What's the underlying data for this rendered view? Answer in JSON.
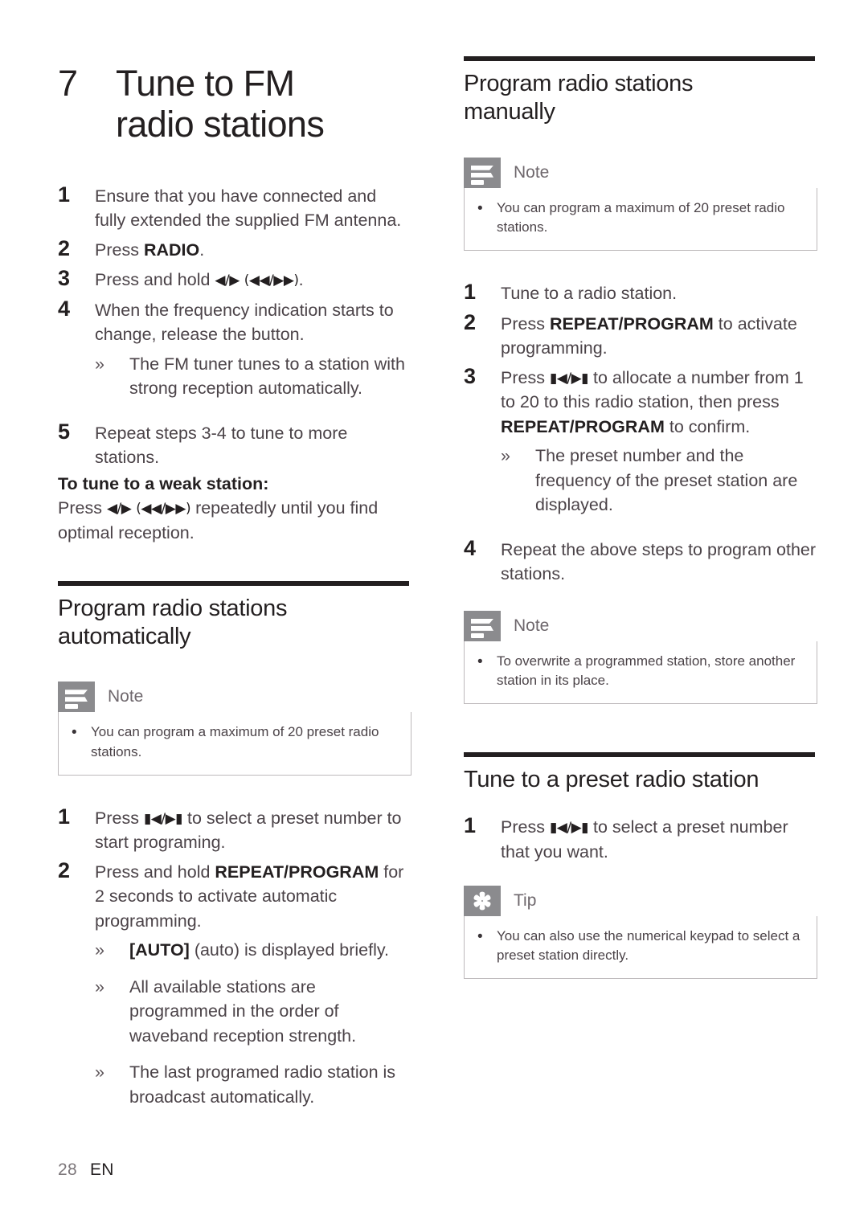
{
  "document": {
    "chapter_number": "7",
    "chapter_title_line1": "Tune to FM",
    "chapter_title_line2": "radio stations",
    "footer_page": "28",
    "footer_language": "EN"
  },
  "symbols": {
    "prev_next": "◀/▶",
    "rew_ff": "(◀◀/▶▶)",
    "skip_prev_next": "▮◀/▶▮"
  },
  "icons": {
    "note": "note-icon",
    "tip": "tip-icon",
    "bullet": "•",
    "subbullet": "»"
  },
  "colors": {
    "rule": "#231f20",
    "icon_badge": "#8b8b8e",
    "callout_border": "#bdb9bb",
    "body_text": "#4b4348",
    "heading_text": "#231f20"
  },
  "left_column": {
    "tune_fm_steps": [
      {
        "num": "1",
        "text": "Ensure that you have connected and fully extended the supplied FM antenna."
      },
      {
        "num": "2",
        "text_pre": "Press ",
        "bold": "RADIO",
        "text_post": "."
      },
      {
        "num": "3",
        "text_pre": "Press and hold ",
        "sym1": "◀/▶",
        "mid": " ",
        "sym2": "(◀◀/▶▶)",
        "text_post": "."
      },
      {
        "num": "4",
        "text": "When the frequency indication starts to change, release the button."
      }
    ],
    "tune_fm_sub_after_4": "The FM tuner tunes to a station with strong reception automatically.",
    "step5": {
      "num": "5",
      "text": "Repeat steps 3-4 to tune to more stations."
    },
    "weak_station_heading": "To tune to a weak station:",
    "weak_station_pre": "Press ",
    "weak_station_sym1": "◀/▶",
    "weak_station_sym2": "(◀◀/▶▶)",
    "weak_station_post": " repeatedly until you find optimal reception.",
    "auto_section": {
      "heading_line1": "Program radio stations",
      "heading_line2": "automatically",
      "note_label": "Note",
      "note_text": "You can program a maximum of 20 preset radio stations.",
      "steps": [
        {
          "num": "1",
          "pre": "Press ",
          "sym": "▮◀/▶▮",
          "post": " to select a preset number to start programing."
        },
        {
          "num": "2",
          "pre": "Press and hold ",
          "bold": "REPEAT/PROGRAM",
          "post": " for 2 seconds to activate automatic programming."
        }
      ],
      "subitems": [
        {
          "bold": "[AUTO]",
          "rest": " (auto) is displayed briefly."
        },
        {
          "bold": "",
          "rest": "All available stations are programmed in the order of waveband reception strength."
        },
        {
          "bold": "",
          "rest": "The last programed radio station is broadcast automatically."
        }
      ]
    }
  },
  "right_column": {
    "manual_section": {
      "heading_line1": "Program radio stations",
      "heading_line2": "manually",
      "note_label": "Note",
      "note_text": "You can program a maximum of 20 preset radio stations.",
      "steps": [
        {
          "num": "1",
          "text": "Tune to a radio station."
        },
        {
          "num": "2",
          "pre": "Press ",
          "bold": "REPEAT/PROGRAM",
          "post": " to activate programming."
        },
        {
          "num": "3",
          "pre": "Press ",
          "sym": "▮◀/▶▮",
          "mid": " to allocate a number from 1 to 20 to this radio station, then press ",
          "bold": "REPEAT/PROGRAM",
          "post": " to confirm."
        }
      ],
      "sub_after_3": "The preset number and the frequency of the preset station are displayed.",
      "step4": {
        "num": "4",
        "text": "Repeat the above steps to program other stations."
      },
      "note2_label": "Note",
      "note2_text": "To overwrite a programmed station, store another station in its place."
    },
    "preset_section": {
      "heading": "Tune to a preset radio station",
      "step1": {
        "num": "1",
        "pre": "Press ",
        "sym": "▮◀/▶▮",
        "post": " to select a preset number that you want."
      },
      "tip_label": "Tip",
      "tip_text": "You can also use the numerical keypad to select a preset station directly."
    }
  }
}
